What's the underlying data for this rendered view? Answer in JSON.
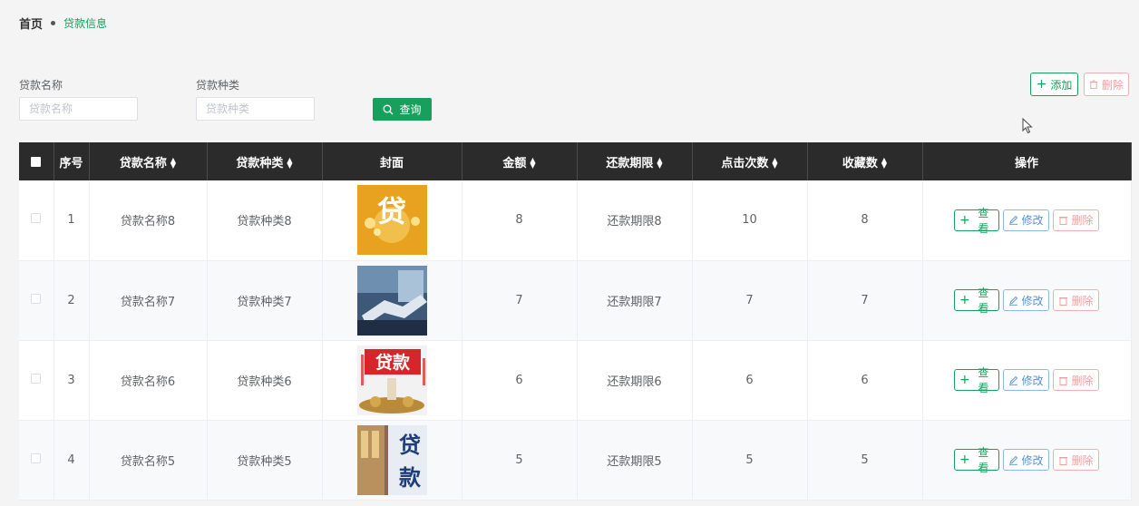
{
  "breadcrumb": {
    "home": "首页",
    "current": "贷款信息"
  },
  "filters": {
    "name_label": "贷款名称",
    "name_placeholder": "贷款名称",
    "type_label": "贷款种类",
    "type_placeholder": "贷款种类",
    "search_label": "查询"
  },
  "toolbar": {
    "add_label": "添加",
    "delete_label": "删除"
  },
  "table": {
    "headers": [
      "序号",
      "贷款名称",
      "贷款种类",
      "封面",
      "金额",
      "还款期限",
      "点击次数",
      "收藏数",
      "操作"
    ],
    "sortable": [
      false,
      true,
      true,
      false,
      true,
      true,
      true,
      true,
      false
    ],
    "rows": [
      {
        "index": "1",
        "name": "贷款名称8",
        "type": "贷款种类8",
        "cover": "cover-gold-loan",
        "amount": "8",
        "term": "还款期限8",
        "clicks": "10",
        "favorites": "8"
      },
      {
        "index": "2",
        "name": "贷款名称7",
        "type": "贷款种类7",
        "cover": "cover-handshake",
        "amount": "7",
        "term": "还款期限7",
        "clicks": "7",
        "favorites": "7"
      },
      {
        "index": "3",
        "name": "贷款名称6",
        "type": "贷款种类6",
        "cover": "cover-red-loan-sign",
        "amount": "6",
        "term": "还款期限6",
        "clicks": "6",
        "favorites": "6"
      },
      {
        "index": "4",
        "name": "贷款名称5",
        "type": "贷款种类5",
        "cover": "cover-blue-loan-sign",
        "amount": "5",
        "term": "还款期限5",
        "clicks": "5",
        "favorites": "5"
      }
    ],
    "actions": {
      "view": "查看",
      "edit": "修改",
      "delete": "删除"
    }
  },
  "colors": {
    "primary": "#17a05c",
    "edit": "#5b8fd9",
    "danger": "#eba2a2",
    "header_bg": "#2b2b2b"
  },
  "cover_texts": {
    "row1": "贷",
    "row3": "贷款",
    "row4_top": "贷",
    "row4_bottom": "款"
  }
}
